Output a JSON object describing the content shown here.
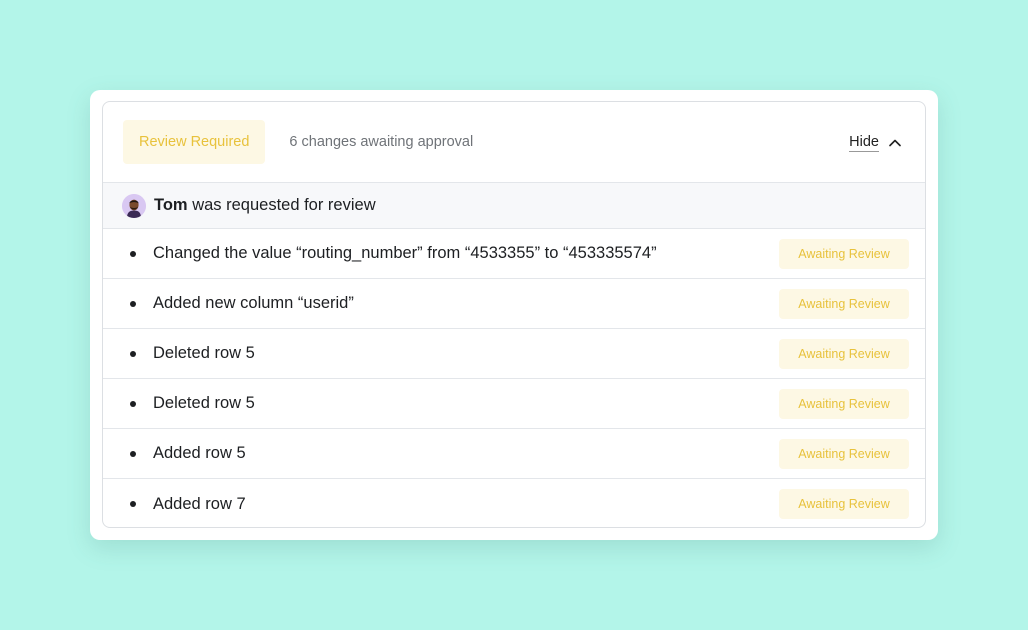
{
  "header": {
    "badge_label": "Review Required",
    "changes_summary": "6 changes awaiting approval",
    "hide_label": "Hide"
  },
  "reviewer": {
    "name": "Tom",
    "action_text": " was requested for review"
  },
  "changes": [
    {
      "text": "Changed the value “routing_number” from “4533355” to “453335574”",
      "status": "Awaiting Review"
    },
    {
      "text": "Added new column “userid”",
      "status": "Awaiting Review"
    },
    {
      "text": "Deleted row 5",
      "status": "Awaiting Review"
    },
    {
      "text": "Deleted row 5",
      "status": "Awaiting Review"
    },
    {
      "text": "Added row 5",
      "status": "Awaiting Review"
    },
    {
      "text": "Added row 7",
      "status": "Awaiting Review"
    }
  ],
  "colors": {
    "background": "#b3f5e9",
    "badge_bg": "#fdf8e4",
    "badge_text": "#e8c23c"
  },
  "icons": {
    "collapse": "chevron-up-icon",
    "avatar": "user-avatar"
  }
}
